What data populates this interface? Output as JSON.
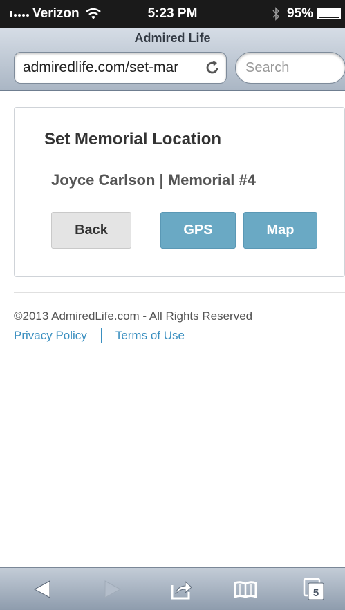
{
  "status_bar": {
    "carrier": "Verizon",
    "time": "5:23 PM",
    "battery": "95%"
  },
  "browser": {
    "page_title": "Admired Life",
    "url": "admiredlife.com/set-mar",
    "search_placeholder": "Search"
  },
  "card": {
    "title": "Set Memorial Location",
    "subtitle": "Joyce Carlson | Memorial #4",
    "buttons": {
      "back": "Back",
      "gps": "GPS",
      "map": "Map"
    }
  },
  "footer": {
    "copyright": "©2013 AdmiredLife.com - All Rights Reserved",
    "privacy_link": "Privacy Policy",
    "terms_link": "Terms of Use"
  },
  "toolbar": {
    "tabs_count": "5"
  },
  "colors": {
    "accent_button": "#6aa9c4",
    "link": "#3a8fc0"
  },
  "icons": [
    "wifi-icon",
    "bluetooth-icon",
    "battery-icon",
    "reload-icon",
    "back-arrow-icon",
    "forward-arrow-icon",
    "share-icon",
    "bookmarks-icon",
    "tabs-icon"
  ]
}
